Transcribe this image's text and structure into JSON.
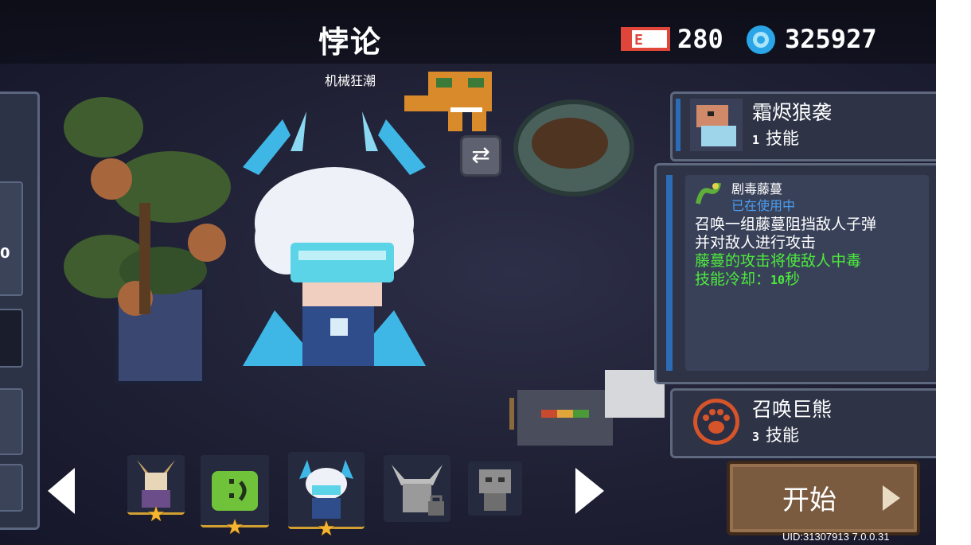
{
  "header": {
    "character_title": "悖论",
    "character_subtitle": "机械狂潮",
    "gems": "280",
    "coins": "325927"
  },
  "left_panel": {
    "partial_number": "0"
  },
  "skills": [
    {
      "name": "霜烬狼袭",
      "level": "1",
      "suffix": "技能"
    },
    {
      "name": "剧毒藤蔓",
      "status": "已在使用中",
      "description": [
        "召唤一组藤蔓阻挡敌人子弹",
        "并对敌人进行攻击"
      ],
      "effect": "藤蔓的攻击将使敌人中毒",
      "cooldown_label": "技能冷却：",
      "cooldown_value": "10",
      "cooldown_unit": "秒"
    },
    {
      "name": "召唤巨熊",
      "level": "3",
      "suffix": "技能"
    }
  ],
  "start_button": {
    "label": "开始"
  },
  "footer": {
    "uid": "UID:31307913 7.0.0.31"
  },
  "colors": {
    "accent_blue": "#4a9df0",
    "effect_green": "#4cea3c",
    "star_gold": "#f4b531"
  }
}
